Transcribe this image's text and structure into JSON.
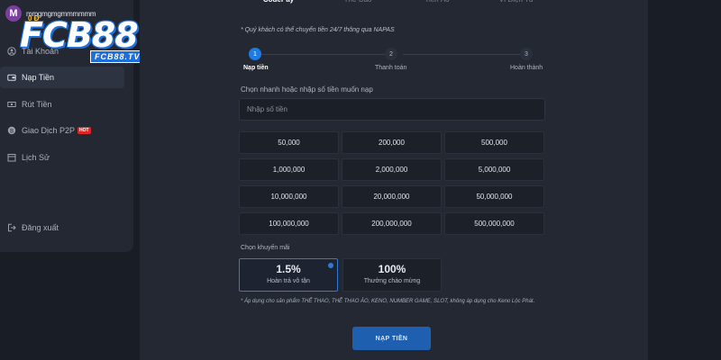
{
  "user": {
    "avatar_letter": "M",
    "username": "mmgmgmgmmmmmm",
    "balance": "0 Đ"
  },
  "logo": {
    "main": "FCB88",
    "sub": "FCB88.TV"
  },
  "sidebar": {
    "items": [
      {
        "label": "Tài Khoản"
      },
      {
        "label": "Nạp Tiền"
      },
      {
        "label": "Rút Tiền"
      },
      {
        "label": "Giao Dịch P2P",
        "badge": "HOT"
      },
      {
        "label": "Lịch Sử"
      },
      {
        "label": "Đăng xuất"
      }
    ]
  },
  "tabs": [
    {
      "label": "CodePay"
    },
    {
      "label": "Thẻ Cào"
    },
    {
      "label": "Tiền Ảo"
    },
    {
      "label": "Ví Điện Tử"
    }
  ],
  "notice": "* Quý khách có thể chuyển tiền 24/7 thông qua NAPAS",
  "steps": [
    {
      "num": "1",
      "label": "Nạp tiền"
    },
    {
      "num": "2",
      "label": "Thanh toán"
    },
    {
      "num": "3",
      "label": "Hoàn thành"
    }
  ],
  "amount": {
    "label": "Chọn nhanh hoặc nhập số tiền muốn nạp",
    "placeholder": "Nhập số tiền",
    "options": [
      "50,000",
      "200,000",
      "500,000",
      "1,000,000",
      "2,000,000",
      "5,000,000",
      "10,000,000",
      "20,000,000",
      "50,000,000",
      "100,000,000",
      "200,000,000",
      "500,000,000"
    ]
  },
  "promo": {
    "label": "Chọn khuyến mãi",
    "options": [
      {
        "value": "1.5%",
        "desc": "Hoàn trả vô tận"
      },
      {
        "value": "100%",
        "desc": "Thưởng chào mừng"
      }
    ],
    "note": "* Áp dụng cho sản phẩm THỂ THAO, THỂ THAO ẢO, KENO, NUMBER GAME, SLOT, không áp dụng cho Keno Lộc Phát."
  },
  "submit_label": "NẠP TIỀN",
  "colors": {
    "accent": "#1e7be0",
    "balance": "#f5c23a",
    "hot": "#e02424",
    "background": "#191d26"
  }
}
